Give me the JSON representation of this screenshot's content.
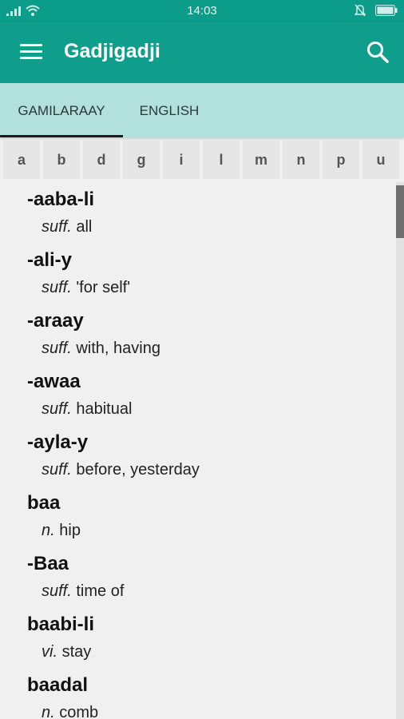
{
  "status_bar": {
    "time": "14:03",
    "icons": [
      "signal-icon",
      "wifi-icon",
      "alarm-off-icon",
      "battery-icon"
    ]
  },
  "app_bar": {
    "title": "Gadjigadji"
  },
  "tabs": [
    {
      "label": "GAMILARAAY",
      "active": true
    },
    {
      "label": "ENGLISH",
      "active": false
    }
  ],
  "letters": [
    "a",
    "b",
    "d",
    "g",
    "i",
    "l",
    "m",
    "n",
    "p",
    "u"
  ],
  "entries": [
    {
      "headword": "-aaba-li",
      "pos": "suff.",
      "gloss": "all"
    },
    {
      "headword": "-ali-y",
      "pos": "suff.",
      "gloss": "'for self'"
    },
    {
      "headword": "-araay",
      "pos": "suff.",
      "gloss": "with, having"
    },
    {
      "headword": "-awaa",
      "pos": "suff.",
      "gloss": "habitual"
    },
    {
      "headword": "-ayla-y",
      "pos": "suff.",
      "gloss": "before, yesterday"
    },
    {
      "headword": "baa",
      "pos": "n.",
      "gloss": "hip"
    },
    {
      "headword": "-Baa",
      "pos": "suff.",
      "gloss": "time of"
    },
    {
      "headword": "baabi-li",
      "pos": "vi.",
      "gloss": "stay"
    },
    {
      "headword": "baadal",
      "pos": "n.",
      "gloss": "comb"
    }
  ],
  "colors": {
    "primary": "#0f9e8b",
    "tab_bar": "#b2e0dc"
  }
}
